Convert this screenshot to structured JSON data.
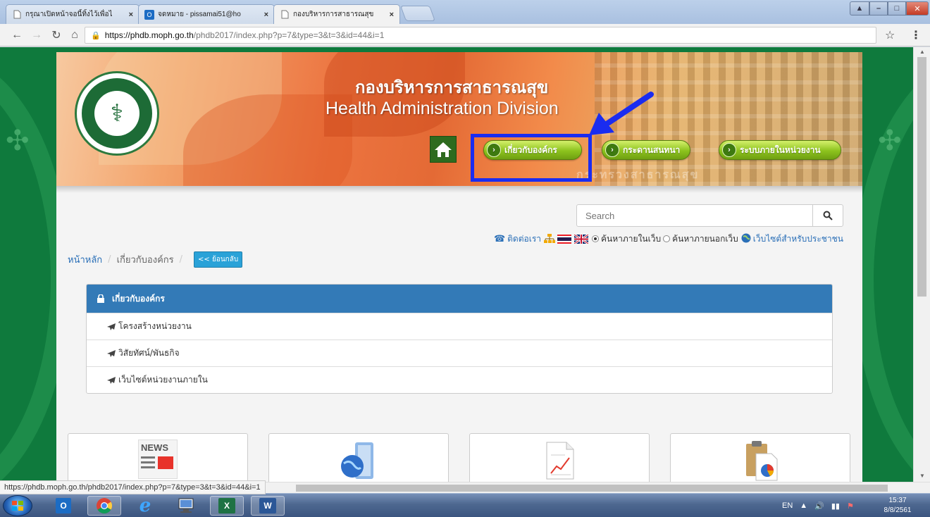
{
  "browser": {
    "tabs": [
      {
        "title": "กรุณาเปิดหน้าจอนี้ทิ้งไว้เพื่อไ",
        "active": false
      },
      {
        "title": "จดหมาย - pissamai51@ho",
        "active": false
      },
      {
        "title": "กองบริหารการสาธารณสุข",
        "active": true
      }
    ],
    "tab_close": "×",
    "url_host": "https://phdb.moph.go.th",
    "url_path": "/phdb2017/index.php?p=7&type=3&t=3&id=44&i=1",
    "status_url": "https://phdb.moph.go.th/phdb2017/index.php?p=7&type=3&t=3&id=44&i=1"
  },
  "header": {
    "title_th": "กองบริหารการสาธารณสุข",
    "title_en": "Health Administration Division",
    "nav": [
      {
        "label": "เกี่ยวกับองค์กร"
      },
      {
        "label": "กระดานสนทนา"
      },
      {
        "label": "ระบบภายในหน่วยงาน"
      }
    ],
    "watermark": "กระทรวงสาธารณสุข",
    "logo_text": "MINISTRY OF PUBLIC HEALTH"
  },
  "search": {
    "placeholder": "Search",
    "contact_label": "ติดต่อเรา",
    "search_internal": "ค้นหาภายในเว็บ",
    "search_external": "ค้นหาภายนอกเว็บ",
    "public_site": "เว็บไซต์สำหรับประชาชน",
    "internal_selected": true
  },
  "breadcrumb": {
    "home": "หน้าหลัก",
    "current": "เกี่ยวกับองค์กร",
    "back_label": "<< ย้อนกลับ"
  },
  "panel": {
    "title": "เกี่ยวกับองค์กร",
    "items": [
      {
        "label": "โครงสร้างหน่วยงาน"
      },
      {
        "label": "วิสัยทัศน์/พันธกิจ"
      },
      {
        "label": "เว็บไซต์หน่วยงานภายใน"
      }
    ]
  },
  "cards": [
    {
      "icon": "news-icon",
      "label": "NEWS"
    },
    {
      "icon": "globe-icon"
    },
    {
      "icon": "document-chart-icon"
    },
    {
      "icon": "clipboard-pie-icon"
    }
  ],
  "taskbar": {
    "lang": "EN",
    "time": "15:37",
    "date": "8/8/2561"
  },
  "colors": {
    "annotation_blue": "#1a2cf0",
    "panel_header": "#337ab7",
    "nav_green": "#8cc21d",
    "page_bg_green": "#0f7a3d"
  }
}
